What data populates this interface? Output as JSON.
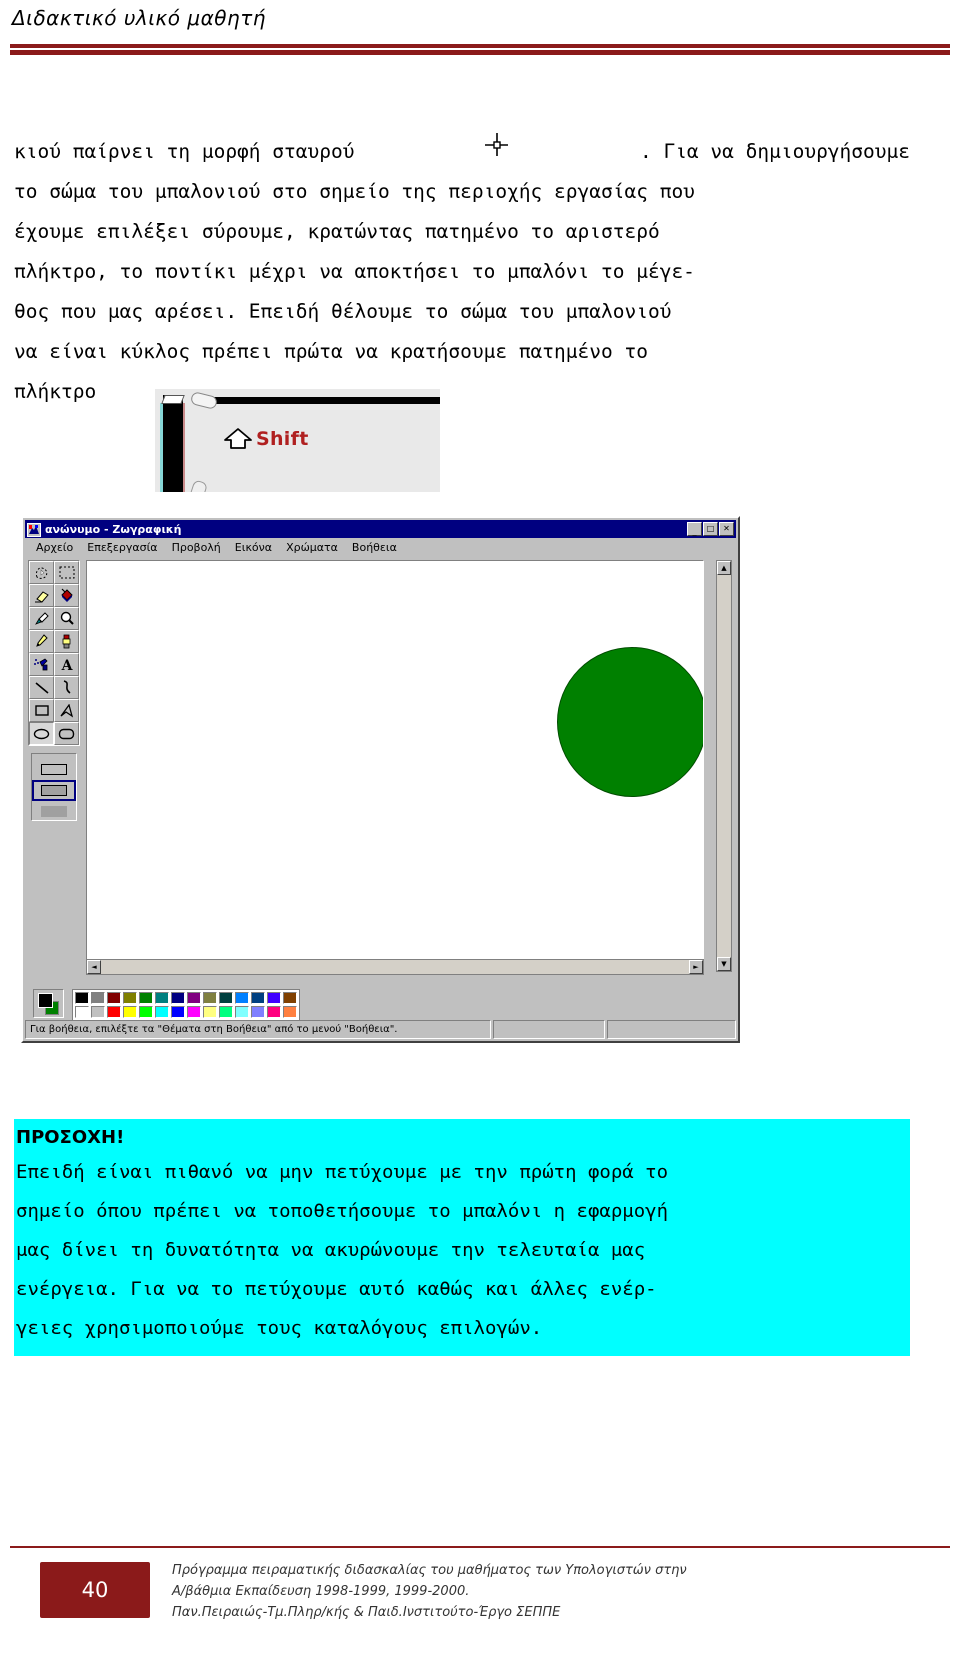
{
  "header": {
    "title": "Διδακτικό υλικό μαθητή"
  },
  "body": {
    "lines": [
      "κιού παίρνει τη μορφή σταυρού",
      ". Για να δημιουργήσουμε",
      "το σώμα του μπαλονιού στο σημείο της περιοχής εργασίας που",
      "έχουμε επιλέξει σύρουμε, κρατώντας πατημένο το αριστερό",
      "πλήκτρο, το ποντίκι μέχρι να αποκτήσει το μπαλόνι το μέγε-",
      "θος που μας αρέσει. Επειδή θέλουμε το σώμα του μπαλονιού",
      "να είναι κύκλος πρέπει πρώτα να κρατήσουμε πατημένο το",
      "πλήκτρο"
    ],
    "crosshair_icon": "crosshair-cursor-icon"
  },
  "shift_figure": {
    "key_label": "Shift",
    "arrow_icon": "shift-arrow-icon",
    "label_color": "#b02020",
    "background": "#e9e9e9"
  },
  "paint_window": {
    "title": "ανώνυμο - Ζωγραφική",
    "app_icon": "paint-app-icon",
    "window_buttons": [
      {
        "name": "minimize",
        "glyph": "_"
      },
      {
        "name": "maximize",
        "glyph": "□"
      },
      {
        "name": "close",
        "glyph": "✕"
      }
    ],
    "menus": [
      {
        "label": "Αρχείο",
        "accel": "Α"
      },
      {
        "label": "Επεξεργασία",
        "accel": "Ε"
      },
      {
        "label": "Προβολή",
        "accel": "ρ"
      },
      {
        "label": "Εικόνα",
        "accel": "κ"
      },
      {
        "label": "Χρώματα",
        "accel": "Χ"
      },
      {
        "label": "Βοήθεια",
        "accel": "Β"
      }
    ],
    "tools": [
      {
        "name": "free-form-select",
        "selected": false
      },
      {
        "name": "rectangle-select",
        "selected": false
      },
      {
        "name": "eraser",
        "selected": false
      },
      {
        "name": "fill-with-color",
        "selected": false
      },
      {
        "name": "pick-color",
        "selected": false
      },
      {
        "name": "magnifier",
        "selected": false
      },
      {
        "name": "pencil",
        "selected": false
      },
      {
        "name": "brush",
        "selected": false
      },
      {
        "name": "airbrush",
        "selected": false
      },
      {
        "name": "text",
        "selected": false
      },
      {
        "name": "line",
        "selected": false
      },
      {
        "name": "curve",
        "selected": false
      },
      {
        "name": "rectangle",
        "selected": false
      },
      {
        "name": "polygon",
        "selected": false
      },
      {
        "name": "ellipse",
        "selected": true
      },
      {
        "name": "rounded-rectangle",
        "selected": false
      }
    ],
    "fill_options": [
      {
        "name": "outline-only",
        "selected": false
      },
      {
        "name": "outline-and-fill",
        "selected": true
      },
      {
        "name": "fill-only",
        "selected": false
      }
    ],
    "canvas": {
      "shape": "green-circle",
      "shape_fill": "#008000",
      "shape_outline": "#004d00",
      "background": "#ffffff"
    },
    "palette": {
      "foreground": "#000000",
      "background": "#008000",
      "row1": [
        "#000000",
        "#808080",
        "#800000",
        "#808000",
        "#008000",
        "#008080",
        "#000080",
        "#800080",
        "#808040",
        "#004040",
        "#0080ff",
        "#004080",
        "#4000ff",
        "#804000"
      ],
      "row2": [
        "#ffffff",
        "#c0c0c0",
        "#ff0000",
        "#ffff00",
        "#00ff00",
        "#00ffff",
        "#0000ff",
        "#ff00ff",
        "#ffff80",
        "#00ff80",
        "#80ffff",
        "#8080ff",
        "#ff0080",
        "#ff8040"
      ]
    },
    "statusbar": {
      "message": "Για βοήθεια, επιλέξτε τα \"Θέματα στη Βοήθεια\" από το μενού \"Βοήθεια\".",
      "pane2": "",
      "pane3": ""
    },
    "scrollbars": {
      "up_arrow": "▲",
      "down_arrow": "▼",
      "left_arrow": "◄",
      "right_arrow": "►"
    }
  },
  "warning": {
    "title": "ΠΡΟΣΟΧΗ!",
    "background": "#00ffff",
    "lines": [
      "Επειδή είναι πιθανό να μην πετύχουμε με την πρώτη φορά το",
      "σημείο όπου πρέπει να τοποθετήσουμε το μπαλόνι η εφαρμογή",
      "μας δίνει τη δυνατότητα να ακυρώνουμε την τελευταία μας",
      "ενέργεια. Για να το πετύχουμε αυτό καθώς και άλλες ενέρ-",
      "γειες χρησιμοποιούμε τους καταλόγους επιλογών."
    ]
  },
  "footer": {
    "page_number": "40",
    "lines": [
      "Πρόγραμμα πειραματικής διδασκαλίας του μαθήματος των Υπολογιστών στην",
      "Α/βάθμια Εκπαίδευση 1998-1999, 1999-2000.",
      "Παν.Πειραιώς-Τμ.Πληρ/κής & Παιδ.Ινστιτούτο-Έργο ΣΕΠΠΕ"
    ]
  }
}
